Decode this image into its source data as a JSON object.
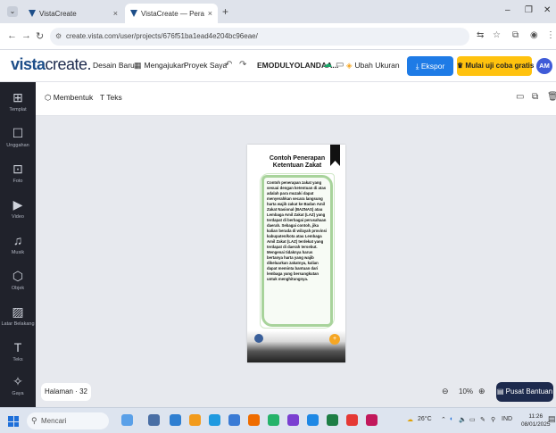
{
  "browser": {
    "tabs": [
      {
        "title": "VistaCreate",
        "close": "×"
      },
      {
        "title": "VistaCreate — Perangkat Lunak",
        "close": "×"
      }
    ],
    "new_tab": "+",
    "window_controls": {
      "minimize": "–",
      "restore": "❐",
      "close": "✕"
    },
    "url": "create.vista.com/user/projects/676f51ba1ead4e204bc96eae/"
  },
  "app": {
    "logo_vista": "vista",
    "logo_create": "create.",
    "menu": {
      "design": "Desain Baru",
      "submit": "Mengajukan",
      "projects": "Proyek Saya"
    },
    "doc_name": "EMODULYOLANDAA...",
    "resize": "Ubah Ukuran",
    "export": "Ekspor",
    "trial": "Mulai uji coba gratis",
    "avatar": "AM"
  },
  "sidebar": {
    "items": [
      {
        "icon": "⊞",
        "label": "Templat"
      },
      {
        "icon": "☐",
        "label": "Unggahan"
      },
      {
        "icon": "⊡",
        "label": "Foto"
      },
      {
        "icon": "▶",
        "label": "Video"
      },
      {
        "icon": "♫",
        "label": "Musik"
      },
      {
        "icon": "⬡",
        "label": "Objek"
      },
      {
        "icon": "▨",
        "label": "Latar Belakang"
      },
      {
        "icon": "T",
        "label": "Teks"
      },
      {
        "icon": "✧",
        "label": "Gaya"
      }
    ]
  },
  "toolbar": {
    "shape": "Membentuk",
    "text": "Teks"
  },
  "page": {
    "title": "Contoh Penerapan Ketentuan Zakat",
    "body": "Contoh penerapan zakat yang sesuai dengan ketentuan di atas adalah para muzaki dapat menyerahkan secara langsung harta wajib zakat ke Badan Amil Zakat Nasional (BAZNAS) atau Lembaga Amil Zakat (LAZ) yang terdapat di berbagai perusahaan daerah. Sebagai contoh, jika kalian berada di wilayah provinsi kabupaten/kota atau Lembaga Amil Zakat (LAZ) terdekat yang terdapat di daerah tersebut. Mengenai tidaknya harus bertanya harta yang wajib dikeluarkan zakatnya, kalian dapat meminta bantuan dari lembaga yang bersangkutan untuk menghitungnya."
  },
  "bottom": {
    "pages": "Halaman",
    "page_count": "32",
    "zoom": "10%",
    "help": "Pusat Bantuan"
  },
  "taskbar": {
    "search": "Mencari",
    "weather": "26°C",
    "lang": "IND",
    "time": "11:26",
    "date": "08/01/2025"
  },
  "colors": {
    "sidebar": "#20222b",
    "export": "#1e7be6",
    "trial": "#ffc20e",
    "help": "#1d2a4d",
    "frame": "#a8d39b"
  }
}
